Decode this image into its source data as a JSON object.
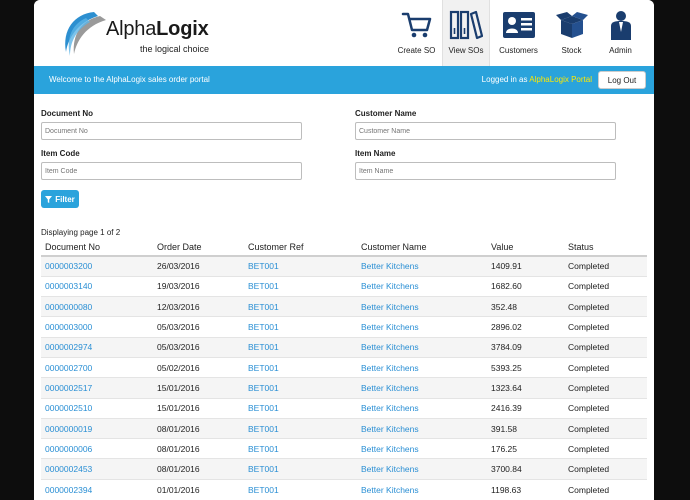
{
  "brand": {
    "title_light": "Alpha",
    "title_bold": "Logix",
    "tagline": "the logical choice"
  },
  "nav": [
    {
      "label": "Create SO",
      "icon": "shopping-cart-icon"
    },
    {
      "label": "View SOs",
      "icon": "binders-icon",
      "active": true
    },
    {
      "label": "Customers",
      "icon": "contact-card-icon"
    },
    {
      "label": "Stock",
      "icon": "box-icon"
    },
    {
      "label": "Admin",
      "icon": "admin-user-icon"
    }
  ],
  "banner": {
    "welcome": "Welcome to the AlphaLogix sales order portal",
    "logged_prefix": "Logged in as",
    "user": "AlphaLogix Portal",
    "logout_label": "Log Out",
    "color": "#2aa3dc"
  },
  "filters": {
    "document_no": {
      "label": "Document No",
      "placeholder": "Document No"
    },
    "customer_name": {
      "label": "Customer Name",
      "placeholder": "Customer Name"
    },
    "item_code": {
      "label": "Item Code",
      "placeholder": "Item Code"
    },
    "item_name": {
      "label": "Item Name",
      "placeholder": "Item Name"
    },
    "filter_label": "Filter"
  },
  "paging": "Displaying page 1 of 2",
  "table": {
    "headers": [
      "Document No",
      "Order Date",
      "Customer Ref",
      "Customer Name",
      "Value",
      "Status"
    ],
    "rows": [
      [
        "0000003200",
        "26/03/2016",
        "BET001",
        "Better Kitchens",
        "1409.91",
        "Completed"
      ],
      [
        "0000003140",
        "19/03/2016",
        "BET001",
        "Better Kitchens",
        "1682.60",
        "Completed"
      ],
      [
        "0000000080",
        "12/03/2016",
        "BET001",
        "Better Kitchens",
        "352.48",
        "Completed"
      ],
      [
        "0000003000",
        "05/03/2016",
        "BET001",
        "Better Kitchens",
        "2896.02",
        "Completed"
      ],
      [
        "0000002974",
        "05/03/2016",
        "BET001",
        "Better Kitchens",
        "3784.09",
        "Completed"
      ],
      [
        "0000002700",
        "05/02/2016",
        "BET001",
        "Better Kitchens",
        "5393.25",
        "Completed"
      ],
      [
        "0000002517",
        "15/01/2016",
        "BET001",
        "Better Kitchens",
        "1323.64",
        "Completed"
      ],
      [
        "0000002510",
        "15/01/2016",
        "BET001",
        "Better Kitchens",
        "2416.39",
        "Completed"
      ],
      [
        "0000000019",
        "08/01/2016",
        "BET001",
        "Better Kitchens",
        "391.58",
        "Completed"
      ],
      [
        "0000000006",
        "08/01/2016",
        "BET001",
        "Better Kitchens",
        "176.25",
        "Completed"
      ],
      [
        "0000002453",
        "08/01/2016",
        "BET001",
        "Better Kitchens",
        "3700.84",
        "Completed"
      ],
      [
        "0000002394",
        "01/01/2016",
        "BET001",
        "Better Kitchens",
        "1198.63",
        "Completed"
      ]
    ]
  }
}
